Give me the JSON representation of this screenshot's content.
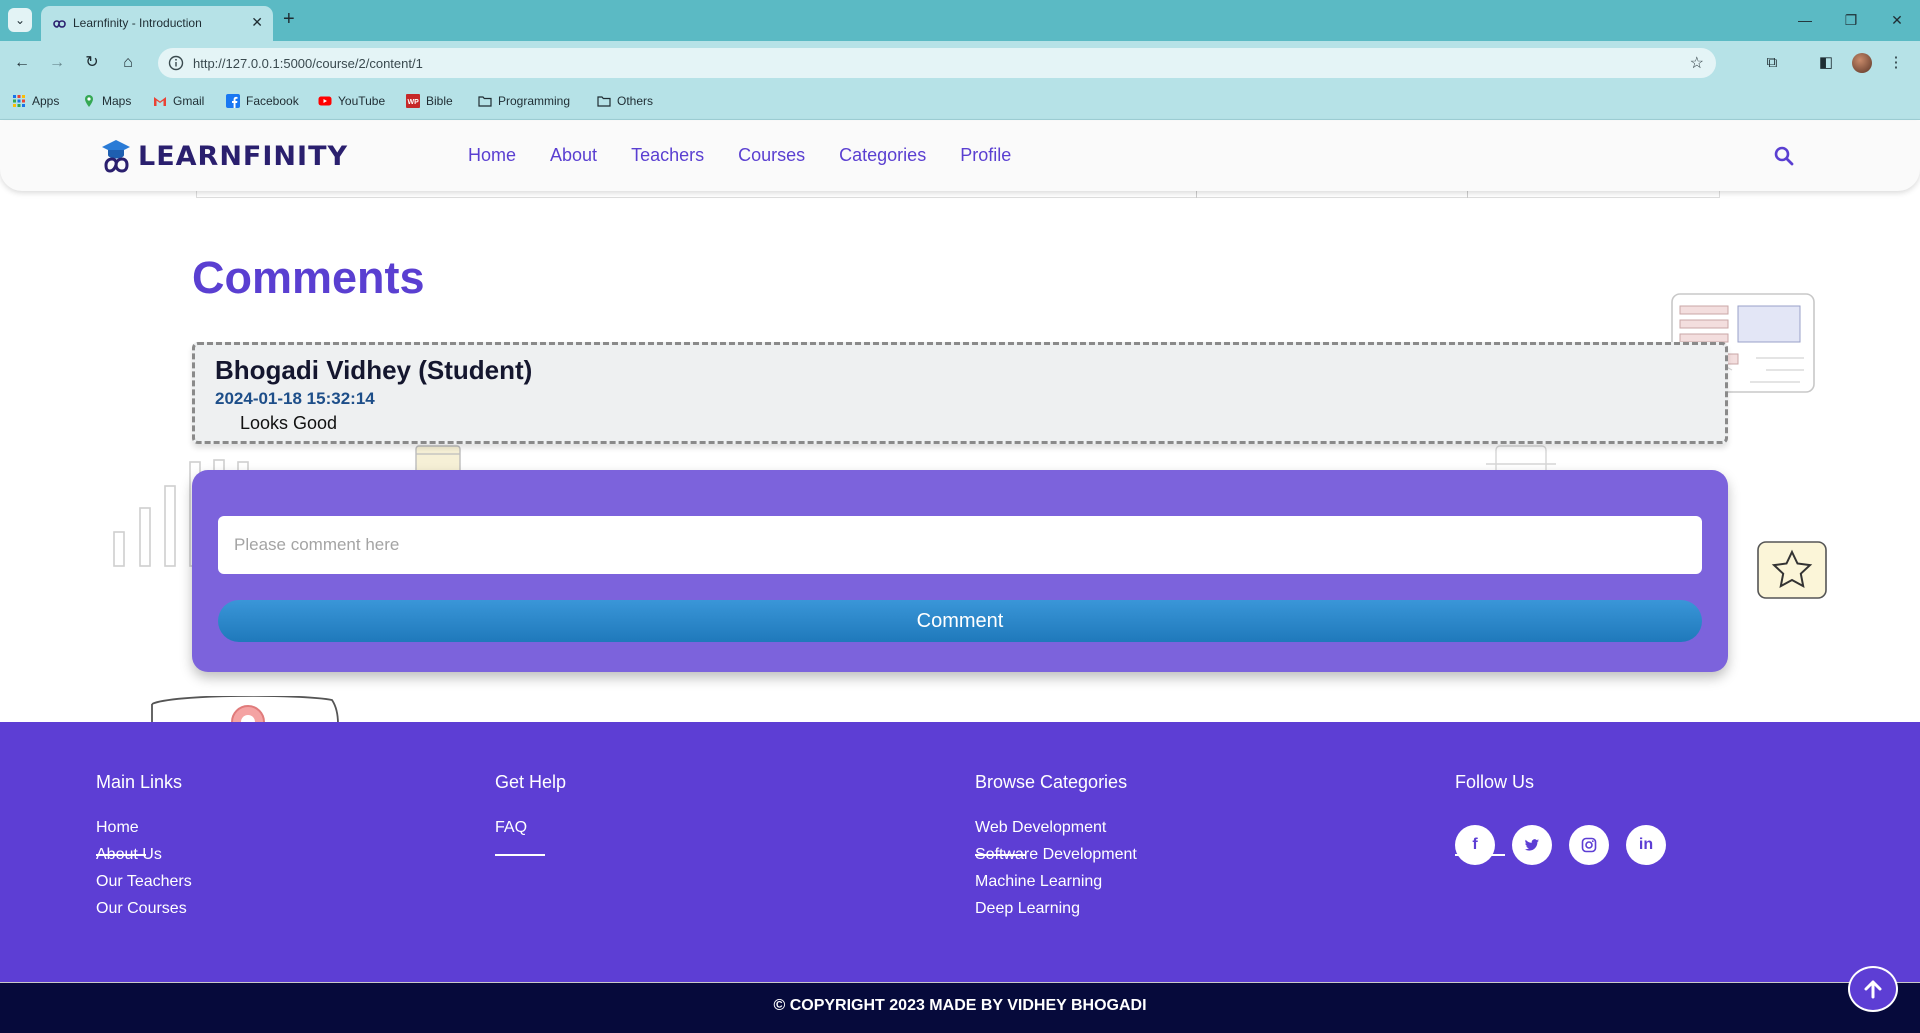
{
  "browser": {
    "tab_title": "Learnfinity - Introduction",
    "url": "http://127.0.0.1:5000/course/2/content/1",
    "bookmarks": [
      "Apps",
      "Maps",
      "Gmail",
      "Facebook",
      "YouTube",
      "Bible",
      "Programming",
      "Others"
    ]
  },
  "header": {
    "logo_text": "LEARNFINITY",
    "nav": [
      "Home",
      "About",
      "Teachers",
      "Courses",
      "Categories",
      "Profile"
    ]
  },
  "comments": {
    "title": "Comments",
    "items": [
      {
        "author": "Bhogadi Vidhey (Student)",
        "date": "2024-01-18 15:32:14",
        "text": "Looks Good"
      }
    ],
    "input_placeholder": "Please comment here",
    "button_label": "Comment"
  },
  "footer": {
    "main_links": {
      "title": "Main Links",
      "items": [
        "Home",
        "About Us",
        "Our Teachers",
        "Our Courses"
      ]
    },
    "get_help": {
      "title": "Get Help",
      "items": [
        "FAQ"
      ]
    },
    "browse_categories": {
      "title": "Browse Categories",
      "items": [
        "Web Development",
        "Software Development",
        "Machine Learning",
        "Deep Learning"
      ]
    },
    "follow_us": {
      "title": "Follow Us",
      "icons": [
        "facebook-icon",
        "twitter-icon",
        "instagram-icon",
        "linkedin-icon"
      ]
    },
    "copyright": "© COPYRIGHT 2023 MADE BY VIDHEY BHOGADI"
  },
  "colors": {
    "brand_purple": "#5d3ed4",
    "form_purple": "#7c63dc",
    "nav_link": "#5a3fd1",
    "copyright_bg": "#060a3b",
    "comment_button": "#2a88cc"
  }
}
